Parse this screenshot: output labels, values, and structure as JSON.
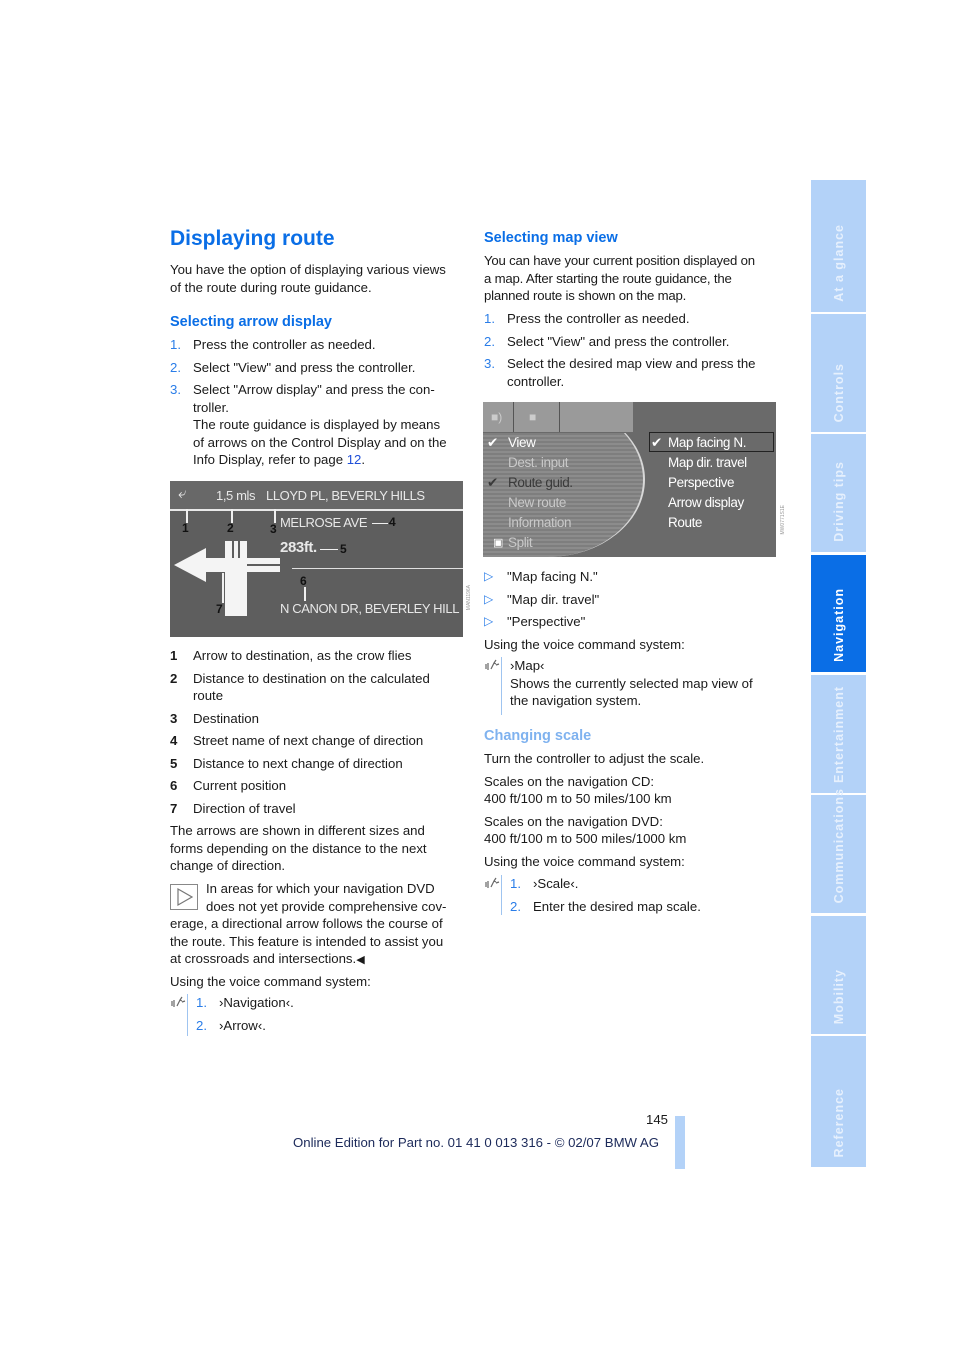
{
  "page_number": "145",
  "footer": "Online Edition for Part no. 01 41 0 013 316 - © 02/07 BMW AG",
  "left": {
    "title": "Displaying route",
    "intro": [
      "You have the option of displaying various views",
      "of the route during route guidance."
    ],
    "arrow_section": {
      "heading": "Selecting arrow display",
      "steps": [
        {
          "num": "1.",
          "text": "Press the controller as needed."
        },
        {
          "num": "2.",
          "text": "Select \"View\" and press the controller."
        },
        {
          "num": "3.",
          "lines": [
            "Select \"Arrow display\" and press the con-",
            "troller.",
            "The route guidance is displayed by means",
            "of arrows on the Control Display and on the"
          ],
          "last_line_prefix": "Info Display, refer to page ",
          "page_link": "12",
          "last_line_suffix": "."
        }
      ]
    },
    "screenshot": {
      "top_distance": "1,5 mls",
      "destination": "LLOYD PL, BEVERLY HILLS",
      "next_street": "MELROSE AVE",
      "next_distance": "283ft.",
      "current_position": "N CANON DR, BEVERLEY HILL",
      "callouts": [
        "1",
        "2",
        "3",
        "4",
        "5",
        "6",
        "7"
      ],
      "side_code": "MAN1196A"
    },
    "legend": [
      {
        "num": "1",
        "lines": [
          "Arrow to destination, as the crow flies"
        ]
      },
      {
        "num": "2",
        "lines": [
          "Distance to destination on the calculated",
          "route"
        ]
      },
      {
        "num": "3",
        "lines": [
          "Destination"
        ]
      },
      {
        "num": "4",
        "lines": [
          "Street name of next change of direction"
        ]
      },
      {
        "num": "5",
        "lines": [
          "Distance to next change of direction"
        ]
      },
      {
        "num": "6",
        "lines": [
          "Current position"
        ]
      },
      {
        "num": "7",
        "lines": [
          "Direction of travel"
        ]
      }
    ],
    "arrows_text": [
      "The arrows are shown in different sizes and",
      "forms depending on the distance to the next",
      "change of direction."
    ],
    "note": {
      "first_lines": [
        "In areas for which your navigation DVD",
        "does not yet provide comprehensive cov-"
      ],
      "rest_lines": [
        "erage, a directional arrow follows the course of",
        "the route. This feature is intended to assist you",
        "at crossroads and intersections."
      ],
      "end_mark": "◀"
    },
    "voice_intro": "Using the voice command system:",
    "voice_steps": [
      {
        "num": "1.",
        "text": "›Navigation‹."
      },
      {
        "num": "2.",
        "text": "›Arrow‹."
      }
    ]
  },
  "right": {
    "map_section": {
      "heading": "Selecting map view",
      "intro": [
        "You can have your current position displayed on",
        "a map. After starting the route guidance, the",
        "planned route is shown on the map."
      ],
      "steps": [
        {
          "num": "1.",
          "lines": [
            "Press the controller as needed."
          ]
        },
        {
          "num": "2.",
          "lines": [
            "Select \"View\" and press the controller."
          ]
        },
        {
          "num": "3.",
          "lines": [
            "Select the desired map view and press the",
            "controller."
          ]
        }
      ]
    },
    "screenshot": {
      "left_menu": [
        {
          "label": "View",
          "checked": true
        },
        {
          "label": "Dest. input",
          "checked": false
        },
        {
          "label": "Route guid.",
          "checked": true
        },
        {
          "label": "New route",
          "checked": false
        },
        {
          "label": "Information",
          "checked": false
        },
        {
          "label": "Split",
          "checked": false
        }
      ],
      "right_menu": [
        {
          "label": "Map facing N.",
          "checked": true,
          "selected": true
        },
        {
          "label": "Map dir. travel",
          "checked": false
        },
        {
          "label": "Perspective",
          "checked": false
        },
        {
          "label": "Arrow display",
          "checked": false
        },
        {
          "label": "Route",
          "checked": false
        }
      ],
      "side_code": "MW0771S1E"
    },
    "options": [
      "\"Map facing N.\"",
      "\"Map dir. travel\"",
      "\"Perspective\""
    ],
    "voice_intro": "Using the voice command system:",
    "voice_map": {
      "command": "›Map‹",
      "lines": [
        "Shows the currently selected map view of",
        "the navigation system."
      ]
    },
    "scale_section": {
      "heading": "Changing scale",
      "text": "Turn the controller to adjust the scale.",
      "cd": [
        "Scales on the navigation CD:",
        "400 ft/100 m to 50 miles/100 km"
      ],
      "dvd": [
        "Scales on the navigation DVD:",
        "400 ft/100 m to 500 miles/1000 km"
      ],
      "voice_intro": "Using the voice command system:",
      "voice_steps": [
        {
          "num": "1.",
          "text": "›Scale‹."
        },
        {
          "num": "2.",
          "text": "Enter the desired map scale."
        }
      ]
    }
  },
  "side_tabs": [
    {
      "label": "At a glance",
      "active": false
    },
    {
      "label": "Controls",
      "active": false
    },
    {
      "label": "Driving tips",
      "active": false
    },
    {
      "label": "Navigation",
      "active": true
    },
    {
      "label": "Entertainment",
      "active": false
    },
    {
      "label": "Communications",
      "active": false
    },
    {
      "label": "Mobility",
      "active": false
    },
    {
      "label": "Reference",
      "active": false
    }
  ],
  "colors": {
    "accent": "#0a6ee6",
    "tab_inactive": "#b3d2f8",
    "link": "#1f4fd8"
  }
}
